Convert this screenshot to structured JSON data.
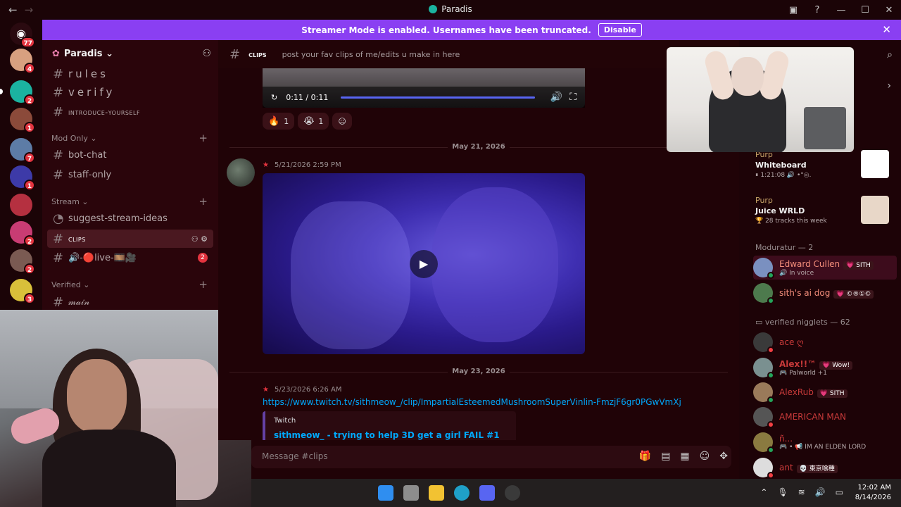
{
  "window": {
    "title": "Paradis"
  },
  "banner": {
    "text": "Streamer Mode is enabled. Usernames have been truncated.",
    "button": "Disable"
  },
  "rail": {
    "dm_badge": "77",
    "servers": [
      {
        "badge": "4",
        "color": "#d8a080"
      },
      {
        "badge": "2",
        "color": "#1bb3a0"
      },
      {
        "badge": "1",
        "color": "#8b4a3a"
      },
      {
        "badge": "7",
        "color": "#5d7ca6"
      },
      {
        "badge": "1",
        "color": "#3d3aa8"
      },
      {
        "badge": "",
        "color": "#b53040"
      },
      {
        "badge": "2",
        "color": "#c83c73"
      },
      {
        "badge": "2",
        "color": "#7a5a52"
      },
      {
        "badge": "3",
        "color": "#d9c03a"
      }
    ]
  },
  "server": {
    "name": "Paradis"
  },
  "channels": {
    "rules": "rules",
    "verify": "verify",
    "introduce": "introduce-yourself",
    "cat_mod": "Mod Only",
    "bot_chat": "bot-chat",
    "staff_only": "staff-only",
    "cat_stream": "Stream",
    "suggest": "suggest-stream-ideas",
    "clips": "clips",
    "live": "🔊-🔴live-🎞️🎥",
    "live_badge": "2",
    "cat_verified": "Verified",
    "main": "𝓂𝒶𝒾𝓃"
  },
  "chat": {
    "channel": "clips",
    "topic": "post your fav clips of me/edits u make in here",
    "video1": {
      "time": "0:11 / 0:11"
    },
    "reactions": [
      {
        "emoji": "🔥",
        "count": "1"
      },
      {
        "emoji": "😭",
        "count": "1"
      }
    ],
    "date1": "May 21, 2026",
    "msg1_time": "5/21/2026 2:59 PM",
    "date2": "May 23, 2026",
    "msg2_time": "5/23/2026 6:26 AM",
    "link": "https://www.twitch.tv/sithmeow_/clip/ImpartialEsteemedMushroomSuperVinlin-FmzjF6gr0PGwVmXj",
    "embed": {
      "provider": "Twitch",
      "title": "sithmeow_ - trying to help 3D get a girl FAIL #1"
    },
    "composer_placeholder": "Message #clips"
  },
  "members": {
    "activities": [
      {
        "who": "Purp",
        "what": "Whiteboard",
        "detail": "⏸ 1:21:08 🔊 •°◎.",
        "thumb": "#ffffff"
      },
      {
        "who": "Purp",
        "what": "Juice WRLD",
        "detail": "🏆 28 tracks this week",
        "thumb": "#e8d7c8"
      }
    ],
    "mod_header": "Moduratur — 2",
    "mods": [
      {
        "name": "Edward Cullen",
        "tag": "💗 SITH",
        "sub": "🔊 In voice",
        "color": "#f28c7a",
        "av": "#7a90c0"
      },
      {
        "name": "sith's ai dog",
        "tag": "💗 ©®①©",
        "sub": "",
        "color": "#f28c7a",
        "av": "#4d7a4d"
      }
    ],
    "verified_header": "▭ verified nigglets — 62",
    "verified": [
      {
        "name": "ace ღ",
        "tag": "",
        "sub": "",
        "color": "#c93a3a",
        "av": "#3a3a3a"
      },
      {
        "name": "Alex!!™",
        "tag": "💗 Wow!",
        "sub": "🎮 Palworld +1",
        "color": "#c93a3a",
        "av": "#7a9090"
      },
      {
        "name": "AlexRub",
        "tag": "💗 SITH",
        "sub": "",
        "color": "#c93a3a",
        "av": "#9a7a5a"
      },
      {
        "name": "AMERICAN MAN",
        "tag": "",
        "sub": "",
        "color": "#c93a3a",
        "av": "#555555"
      },
      {
        "name": "ñ...",
        "tag": "",
        "sub": "🎮 • 📢 IM AN ELDEN LORD",
        "color": "#c93a3a",
        "av": "#8a7a40"
      },
      {
        "name": "ant",
        "tag": "💀 東京喰種",
        "sub": "",
        "color": "#c93a3a",
        "av": "#dddddd"
      }
    ]
  },
  "taskbar": {
    "time": "12:02 AM",
    "date": "8/14/2026"
  }
}
